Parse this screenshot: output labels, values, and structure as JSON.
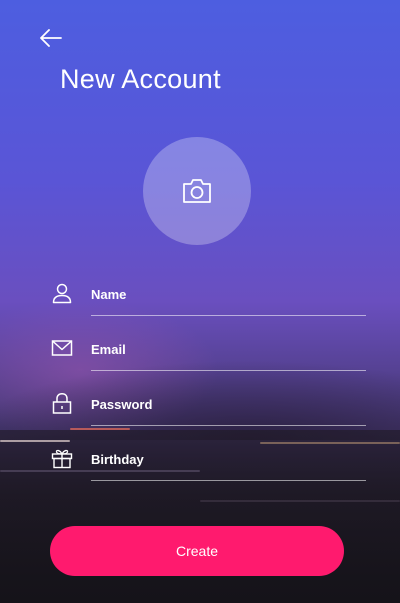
{
  "header": {
    "back_icon": "arrow-left-icon",
    "title": "New Account"
  },
  "avatar": {
    "icon": "camera-icon"
  },
  "form": {
    "fields": [
      {
        "icon": "user-icon",
        "placeholder": "Name",
        "value": ""
      },
      {
        "icon": "envelope-icon",
        "placeholder": "Email",
        "value": ""
      },
      {
        "icon": "lock-icon",
        "placeholder": "Password",
        "value": ""
      },
      {
        "icon": "gift-icon",
        "placeholder": "Birthday",
        "value": ""
      }
    ],
    "submit_label": "Create"
  },
  "colors": {
    "accent": "#ff1a6e",
    "gradient_top": "#4d5ee0",
    "gradient_bottom": "#1c1820"
  }
}
